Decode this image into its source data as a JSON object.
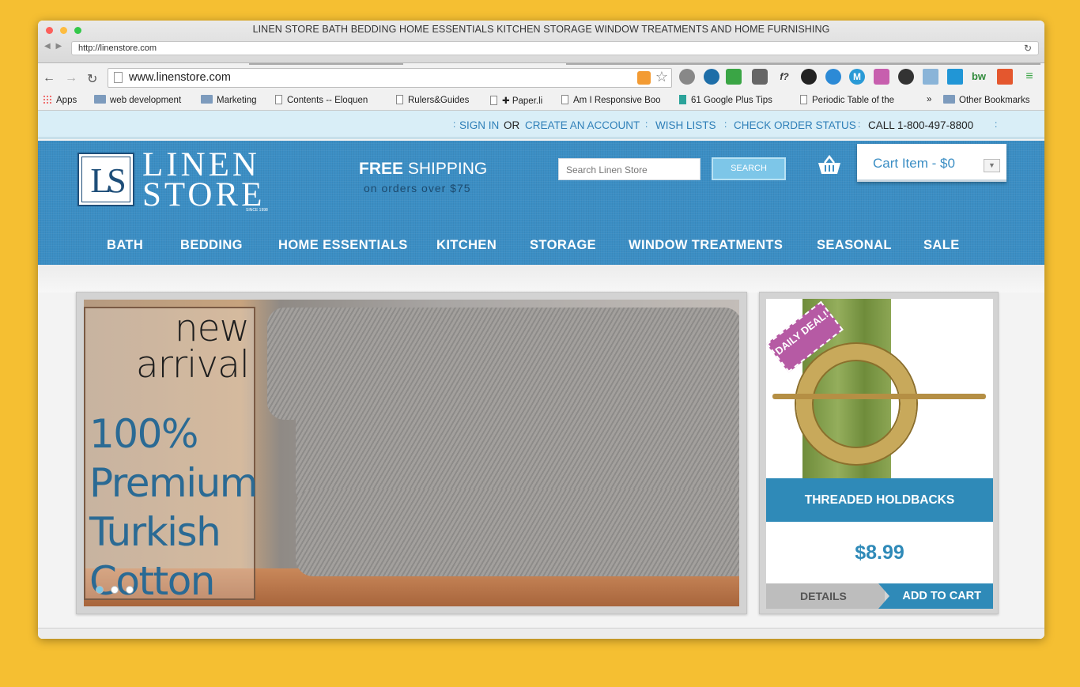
{
  "window": {
    "title": "LINEN STORE BATH BEDDING HOME ESSENTIALS KITCHEN STORAGE WINDOW TREATMENTS AND HOME FURNISHING",
    "address": "http://linenstore.com"
  },
  "browser": {
    "url": "www.linenstore.com",
    "bookmarks": [
      {
        "label": "Apps",
        "icon": "apps-grid-icon"
      },
      {
        "label": "web development",
        "icon": "folder-icon"
      },
      {
        "label": "Marketing",
        "icon": "folder-icon"
      },
      {
        "label": "Contents -- Eloquen",
        "icon": "page-icon"
      },
      {
        "label": "Rulers&Guides",
        "icon": "page-icon"
      },
      {
        "label": "✚ Paper.li",
        "icon": "page-icon"
      },
      {
        "label": "Am I Responsive Boo",
        "icon": "page-icon"
      },
      {
        "label": "61 Google Plus Tips",
        "icon": "page-icon"
      },
      {
        "label": "Periodic Table of the",
        "icon": "page-icon"
      },
      {
        "label": "»",
        "icon": ""
      },
      {
        "label": "Other Bookmarks",
        "icon": "folder-icon"
      }
    ]
  },
  "topbar": {
    "sign_in": "SIGN IN",
    "or": "OR",
    "create_account": "CREATE AN ACCOUNT",
    "wish_lists": "WISH LISTS",
    "check_order": "CHECK ORDER STATUS",
    "phone": "CALL 1-800-497-8800"
  },
  "header": {
    "logo_mark": "LS",
    "logo_line1": "LINEN",
    "logo_line2": "STORE",
    "logo_since": "SINCE 1998",
    "shipping_bold": "FREE",
    "shipping_rest": " SHIPPING",
    "shipping_sub": "on orders over $75",
    "search_placeholder": "Search Linen Store",
    "search_button": "SEARCH",
    "cart_label": "Cart Item - $0",
    "cart_dropdown": "▼"
  },
  "nav": [
    "BATH",
    "BEDDING",
    "HOME ESSENTIALS",
    "KITCHEN",
    "STORAGE",
    "WINDOW TREATMENTS",
    "SEASONAL",
    "SALE"
  ],
  "hero": {
    "line1": "new",
    "line2": "arrival",
    "big1": "100%",
    "big2": "Premium",
    "big3": "Turkish",
    "big4": "Cotton"
  },
  "deal": {
    "tag": "DAILY DEAL!",
    "name": "THREADED HOLDBACKS",
    "price": "$8.99",
    "details": "DETAILS",
    "add_to_cart": "ADD TO CART"
  },
  "colors": {
    "brand_blue": "#3b8ec4",
    "deal_blue": "#2f8ab8",
    "tag_purple": "#b65aa4",
    "desktop": "#f5bf32"
  }
}
